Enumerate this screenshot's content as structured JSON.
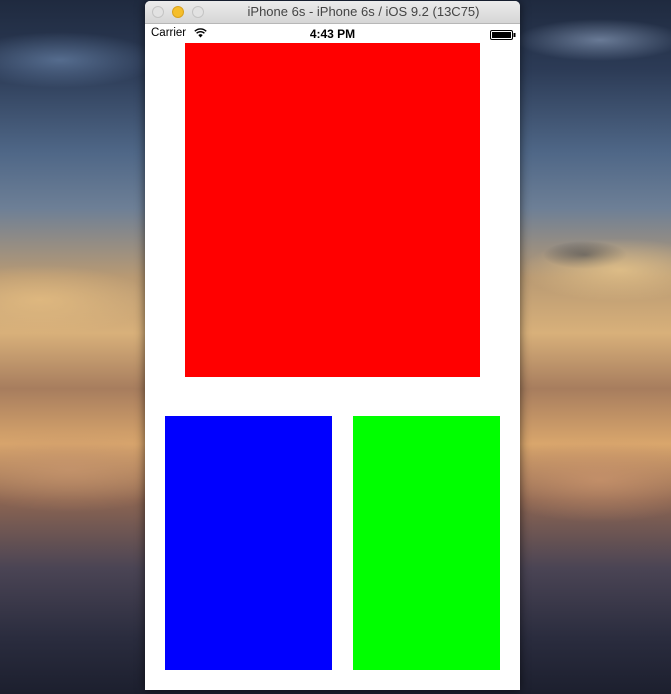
{
  "window": {
    "title": "iPhone 6s - iPhone 6s / iOS 9.2 (13C75)"
  },
  "status_bar": {
    "carrier": "Carrier",
    "time": "4:43 PM",
    "wifi_icon": "wifi-icon",
    "battery_icon": "battery-icon"
  },
  "views": {
    "top_view_color": "#ff0000",
    "bottom_left_view_color": "#0000ff",
    "bottom_right_view_color": "#00ff00"
  }
}
